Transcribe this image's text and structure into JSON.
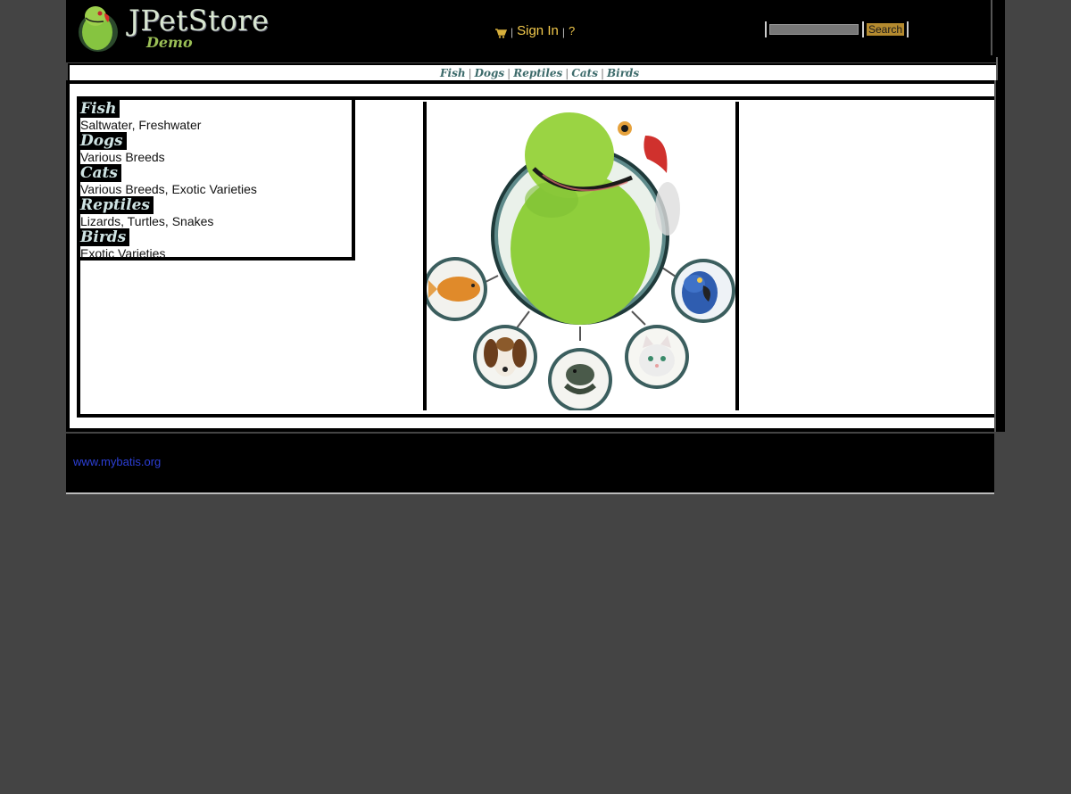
{
  "header": {
    "logo_title": "JPetStore",
    "logo_subtitle": "Demo",
    "cart_icon": "cart-icon",
    "sign_in": "Sign In",
    "help": "?",
    "separator": "|",
    "search_placeholder": "",
    "search_button": "Search"
  },
  "quicklinks": [
    "Fish",
    "Dogs",
    "Reptiles",
    "Cats",
    "Birds"
  ],
  "sidebar": {
    "categories": [
      {
        "name": "Fish",
        "description": "Saltwater, Freshwater"
      },
      {
        "name": "Dogs",
        "description": "Various Breeds"
      },
      {
        "name": "Cats",
        "description": "Various Breeds, Exotic Varieties"
      },
      {
        "name": "Reptiles",
        "description": "Lizards, Turtles, Snakes"
      },
      {
        "name": "Birds",
        "description": "Exotic Varieties"
      }
    ]
  },
  "main_image": {
    "center": "parrot",
    "around": [
      "goldfish",
      "beagle",
      "lizard",
      "cat",
      "macaw"
    ]
  },
  "footer": {
    "link": "www.mybatis.org"
  },
  "colors": {
    "background": "#444444",
    "header": "#000000",
    "menu_link": "#f2c94c",
    "footer_link": "#2c3fd6",
    "category_text": "#cfe3e3"
  }
}
